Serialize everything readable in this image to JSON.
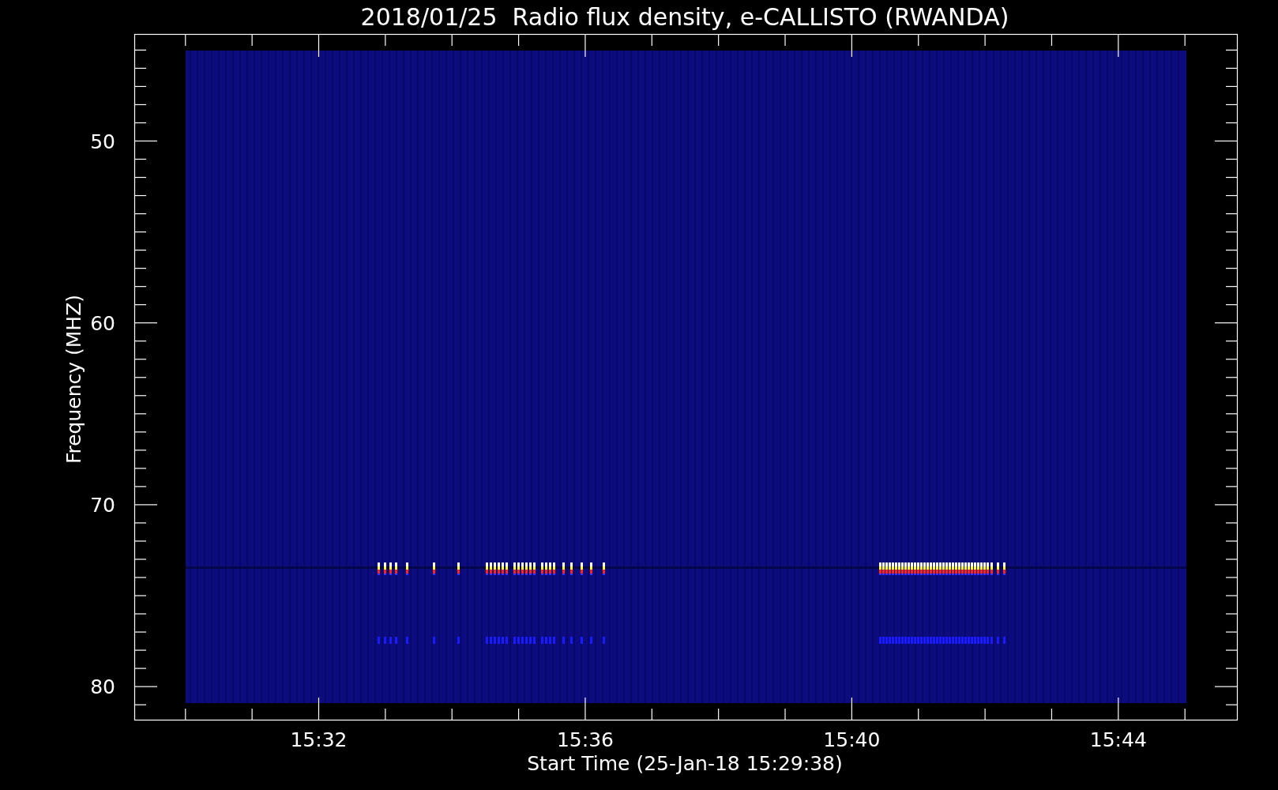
{
  "title": "2018/01/25  Radio flux density, e-CALLISTO (RWANDA)",
  "y_axis": {
    "label": "Frequency (MHZ)",
    "ticks": [
      "50",
      "60",
      "70",
      "80"
    ]
  },
  "x_axis": {
    "label": "Start Time (25-Jan-18 15:29:38)",
    "ticks": [
      "15:32",
      "15:36",
      "15:40",
      "15:44"
    ]
  }
}
